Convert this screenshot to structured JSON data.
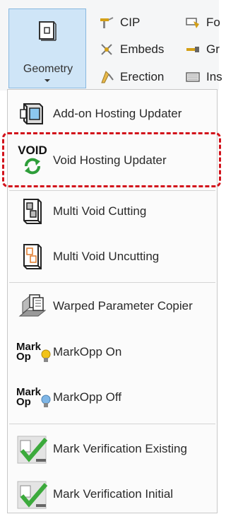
{
  "ribbon": {
    "geometry_label": "Geometry",
    "col1": [
      "CIP",
      "Embeds",
      "Erection"
    ],
    "col2": [
      "Fo",
      "Gr",
      "Ins"
    ]
  },
  "menu": {
    "items": [
      {
        "label": "Add-on Hosting Updater",
        "icon": "addon-hosting-icon"
      },
      {
        "label": "Void Hosting Updater",
        "icon": "void-refresh-icon",
        "icon_text": "VOID",
        "highlighted": true
      },
      {
        "label": "Multi Void Cutting",
        "icon": "multi-void-cutting-icon"
      },
      {
        "label": "Multi Void Uncutting",
        "icon": "multi-void-uncutting-icon"
      },
      {
        "label": "Warped Parameter Copier",
        "icon": "warped-copier-icon"
      },
      {
        "label": "MarkOpp On",
        "icon": "markopp-on-icon",
        "icon_text": [
          "Mark",
          "Op"
        ]
      },
      {
        "label": "MarkOpp Off",
        "icon": "markopp-off-icon",
        "icon_text": [
          "Mark",
          "Op"
        ]
      },
      {
        "label": "Mark Verification Existing",
        "icon": "mark-verification-existing-icon"
      },
      {
        "label": "Mark Verification Initial",
        "icon": "mark-verification-initial-icon"
      }
    ]
  },
  "colors": {
    "highlight": "#d2121b",
    "ribbon_button_bg": "#cfe5f7",
    "ribbon_button_border": "#88b8e0",
    "void_green": "#2e9e3a",
    "check_green": "#3caa3c",
    "bulb_yellow": "#f2c318",
    "bulb_blue": "#7fb6e6"
  }
}
